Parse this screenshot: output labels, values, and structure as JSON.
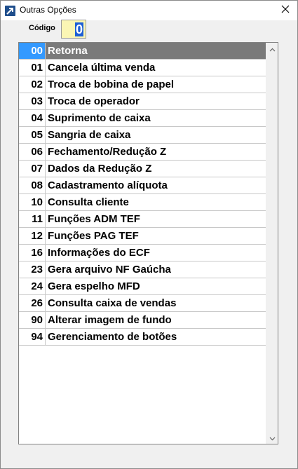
{
  "window": {
    "title": "Outras Opções",
    "close_label": "✕"
  },
  "codigo": {
    "label": "Código",
    "value": "0"
  },
  "options": [
    {
      "code": "00",
      "label": "Retorna",
      "selected": true
    },
    {
      "code": "01",
      "label": "Cancela última venda"
    },
    {
      "code": "02",
      "label": "Troca de bobina de papel"
    },
    {
      "code": "03",
      "label": "Troca de operador"
    },
    {
      "code": "04",
      "label": "Suprimento de caixa"
    },
    {
      "code": "05",
      "label": "Sangria de caixa"
    },
    {
      "code": "06",
      "label": "Fechamento/Redução Z"
    },
    {
      "code": "07",
      "label": "Dados da Redução Z"
    },
    {
      "code": "08",
      "label": "Cadastramento alíquota"
    },
    {
      "code": "10",
      "label": "Consulta cliente"
    },
    {
      "code": "11",
      "label": "Funções ADM TEF"
    },
    {
      "code": "12",
      "label": "Funções PAG TEF"
    },
    {
      "code": "16",
      "label": "Informações do ECF"
    },
    {
      "code": "23",
      "label": "Gera arquivo NF Gaúcha"
    },
    {
      "code": "24",
      "label": "Gera espelho MFD"
    },
    {
      "code": "26",
      "label": "Consulta caixa de vendas"
    },
    {
      "code": "90",
      "label": "Alterar imagem de fundo"
    },
    {
      "code": "94",
      "label": "Gerenciamento de botões"
    }
  ],
  "colors": {
    "selected_code_bg": "#3399ff",
    "selected_label_bg": "#7a7a7a",
    "input_bg": "#fbf6b4"
  },
  "icons": {
    "app": "app-icon",
    "close": "close-icon",
    "scroll_up": "chevron-up-icon",
    "scroll_down": "chevron-down-icon"
  }
}
